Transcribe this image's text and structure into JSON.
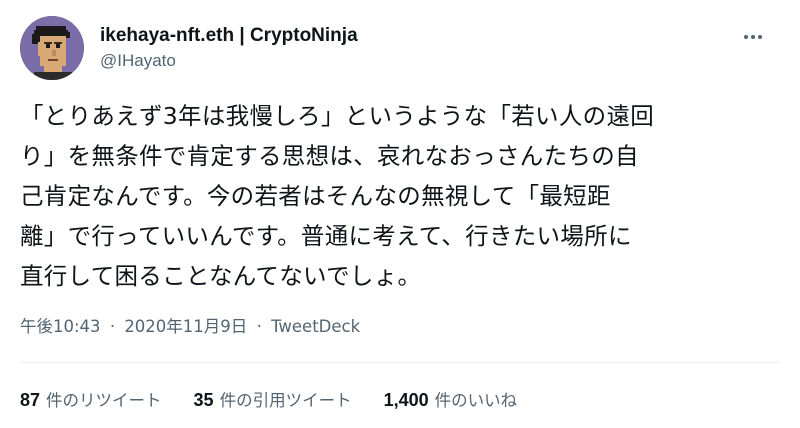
{
  "author": {
    "display_name": "ikehaya-nft.eth | CryptoNinja",
    "handle": "@IHayato",
    "avatar_icon": "pixel-art-ninja-avatar",
    "avatar_bg": "#7b6ea8"
  },
  "more_icon": "more-options-icon",
  "tweet": {
    "lines": [
      "「とりあえず3年は我慢しろ」というような「若い人の遠回",
      "り」を無条件で肯定する思想は、哀れなおっさんたちの自",
      "己肯定なんです。今の若者はそんなの無視して「最短距",
      "離」で行っていいんです。普通に考えて、行きたい場所に",
      "直行して困ることなんてないでしょ。"
    ]
  },
  "meta": {
    "time": "午後10:43",
    "separator": "·",
    "date": "2020年11月9日",
    "source": "TweetDeck"
  },
  "stats": {
    "retweets_count": "87",
    "retweets_label": "件のリツイート",
    "quotes_count": "35",
    "quotes_label": "件の引用ツイート",
    "likes_count": "1,400",
    "likes_label": "件のいいね"
  },
  "colors": {
    "text": "#0f1419",
    "secondary": "#536471",
    "divider": "#eff3f4"
  }
}
